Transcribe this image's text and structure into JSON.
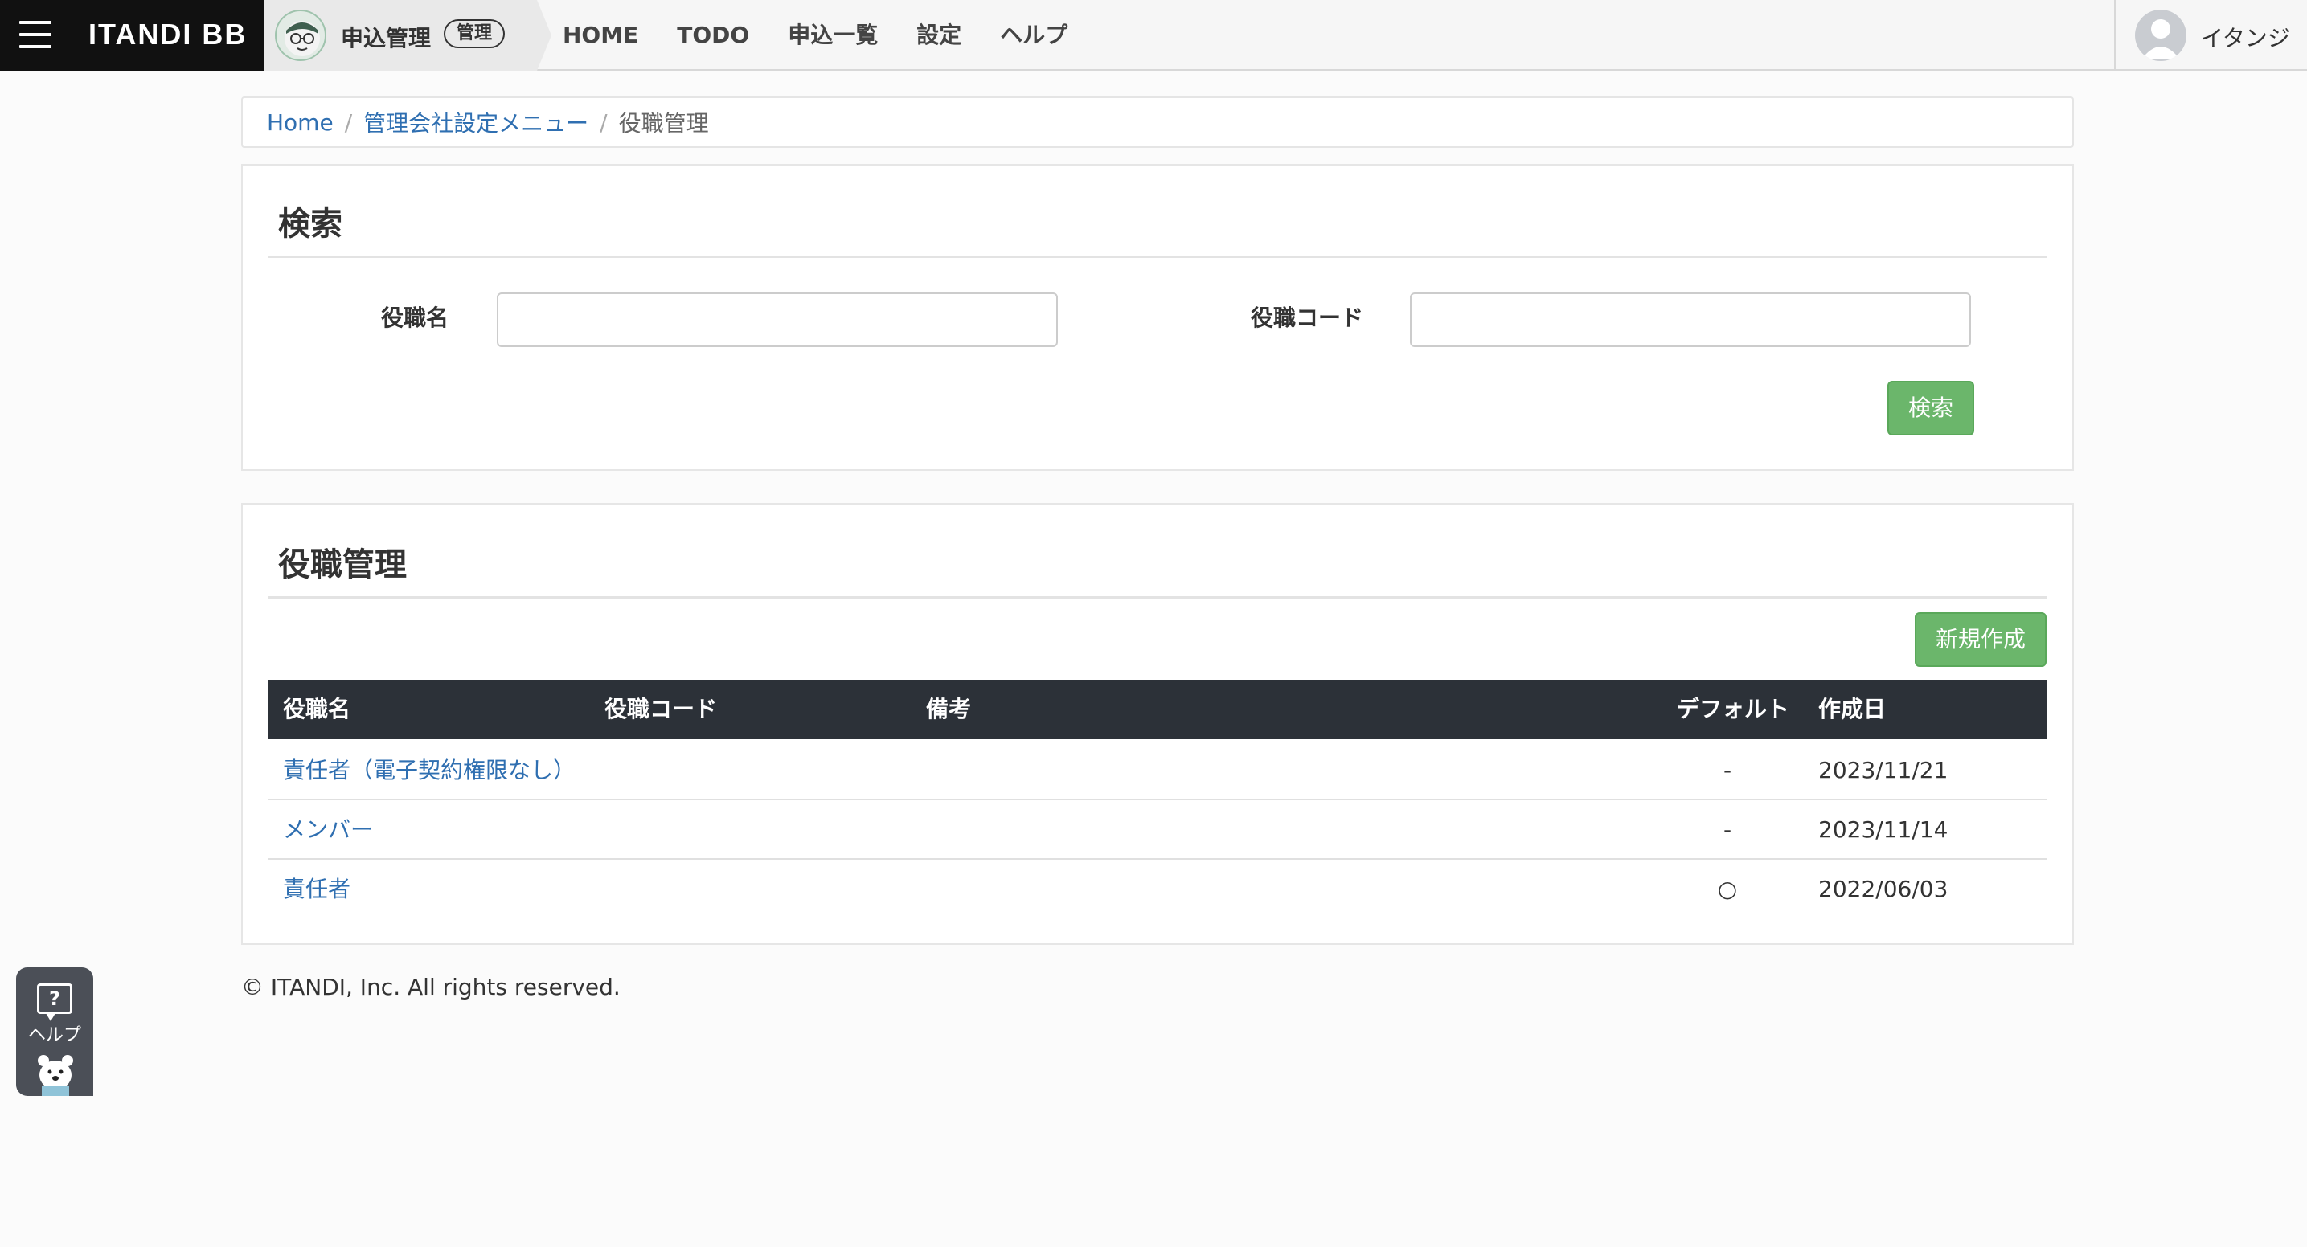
{
  "navbar": {
    "brand": "ITANDI BB",
    "app_name": "申込管理",
    "app_badge": "管理",
    "links": [
      "HOME",
      "TODO",
      "申込一覧",
      "設定",
      "ヘルプ"
    ],
    "user_name": "イタンジ"
  },
  "breadcrumb": {
    "home": "Home",
    "parent": "管理会社設定メニュー",
    "current": "役職管理",
    "separator": "/"
  },
  "search": {
    "title": "検索",
    "name_label": "役職名",
    "name_value": "",
    "code_label": "役職コード",
    "code_value": "",
    "submit_label": "検索"
  },
  "list": {
    "title": "役職管理",
    "new_button": "新規作成",
    "columns": [
      "役職名",
      "役職コード",
      "備考",
      "デフォルト",
      "作成日"
    ],
    "rows": [
      {
        "name": "責任者（電子契約権限なし）",
        "code": "",
        "note": "",
        "default": "-",
        "created": "2023/11/21"
      },
      {
        "name": "メンバー",
        "code": "",
        "note": "",
        "default": "-",
        "created": "2023/11/14"
      },
      {
        "name": "責任者",
        "code": "",
        "note": "",
        "default": "○",
        "created": "2022/06/03"
      }
    ]
  },
  "footer": {
    "copyright": "© ITANDI, Inc. All rights reserved."
  },
  "help_widget": {
    "icon_glyph": "?",
    "label": "ヘルプ"
  },
  "colors": {
    "brand_bg": "#111111",
    "accent_green": "#6bb66b",
    "link_blue": "#2f6fb1",
    "table_header_bg": "#2c3138"
  }
}
